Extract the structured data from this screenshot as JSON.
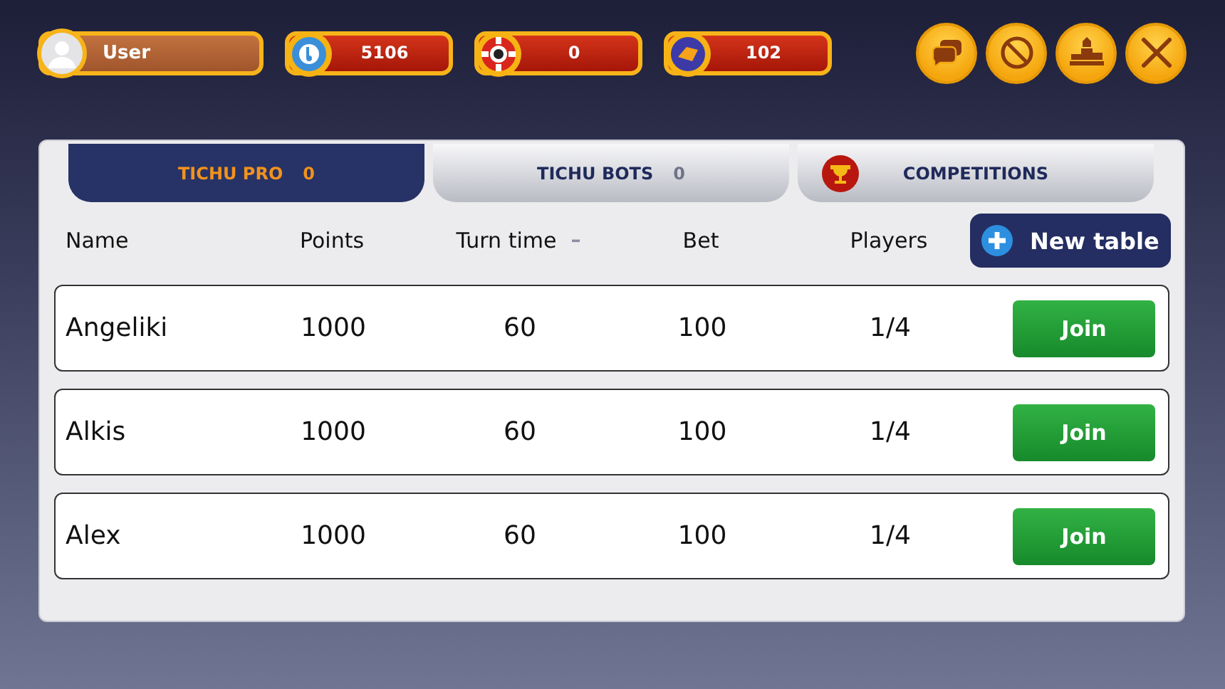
{
  "user": {
    "name": "User"
  },
  "currencies": [
    {
      "kind": "coin",
      "amount": "5106"
    },
    {
      "kind": "chip",
      "amount": "0"
    },
    {
      "kind": "token",
      "amount": "102"
    }
  ],
  "top_buttons": [
    {
      "kind": "chat"
    },
    {
      "kind": "block"
    },
    {
      "kind": "podium"
    },
    {
      "kind": "close"
    }
  ],
  "tabs": [
    {
      "kind": "counter",
      "label": "TICHU PRO",
      "count": "0",
      "selected": true
    },
    {
      "kind": "counter",
      "label": "TICHU BOTS",
      "count": "0",
      "selected": false
    },
    {
      "kind": "trophy",
      "label": "COMPETITIONS",
      "selected": false
    }
  ],
  "table": {
    "columns": [
      {
        "label": "Name"
      },
      {
        "label": "Points"
      },
      {
        "label": "Turn time",
        "sort_mark": "–"
      },
      {
        "label": "Bet"
      },
      {
        "label": "Players"
      }
    ],
    "new_table_button": "New table",
    "rows": [
      {
        "name": "Angeliki",
        "points": "1000",
        "turn_time": "60",
        "bet": "100",
        "players": "1/4",
        "action": "Join"
      },
      {
        "name": "Alkis",
        "points": "1000",
        "turn_time": "60",
        "bet": "100",
        "players": "1/4",
        "action": "Join"
      },
      {
        "name": "Alex",
        "points": "1000",
        "turn_time": "60",
        "bet": "100",
        "players": "1/4",
        "action": "Join"
      }
    ]
  }
}
